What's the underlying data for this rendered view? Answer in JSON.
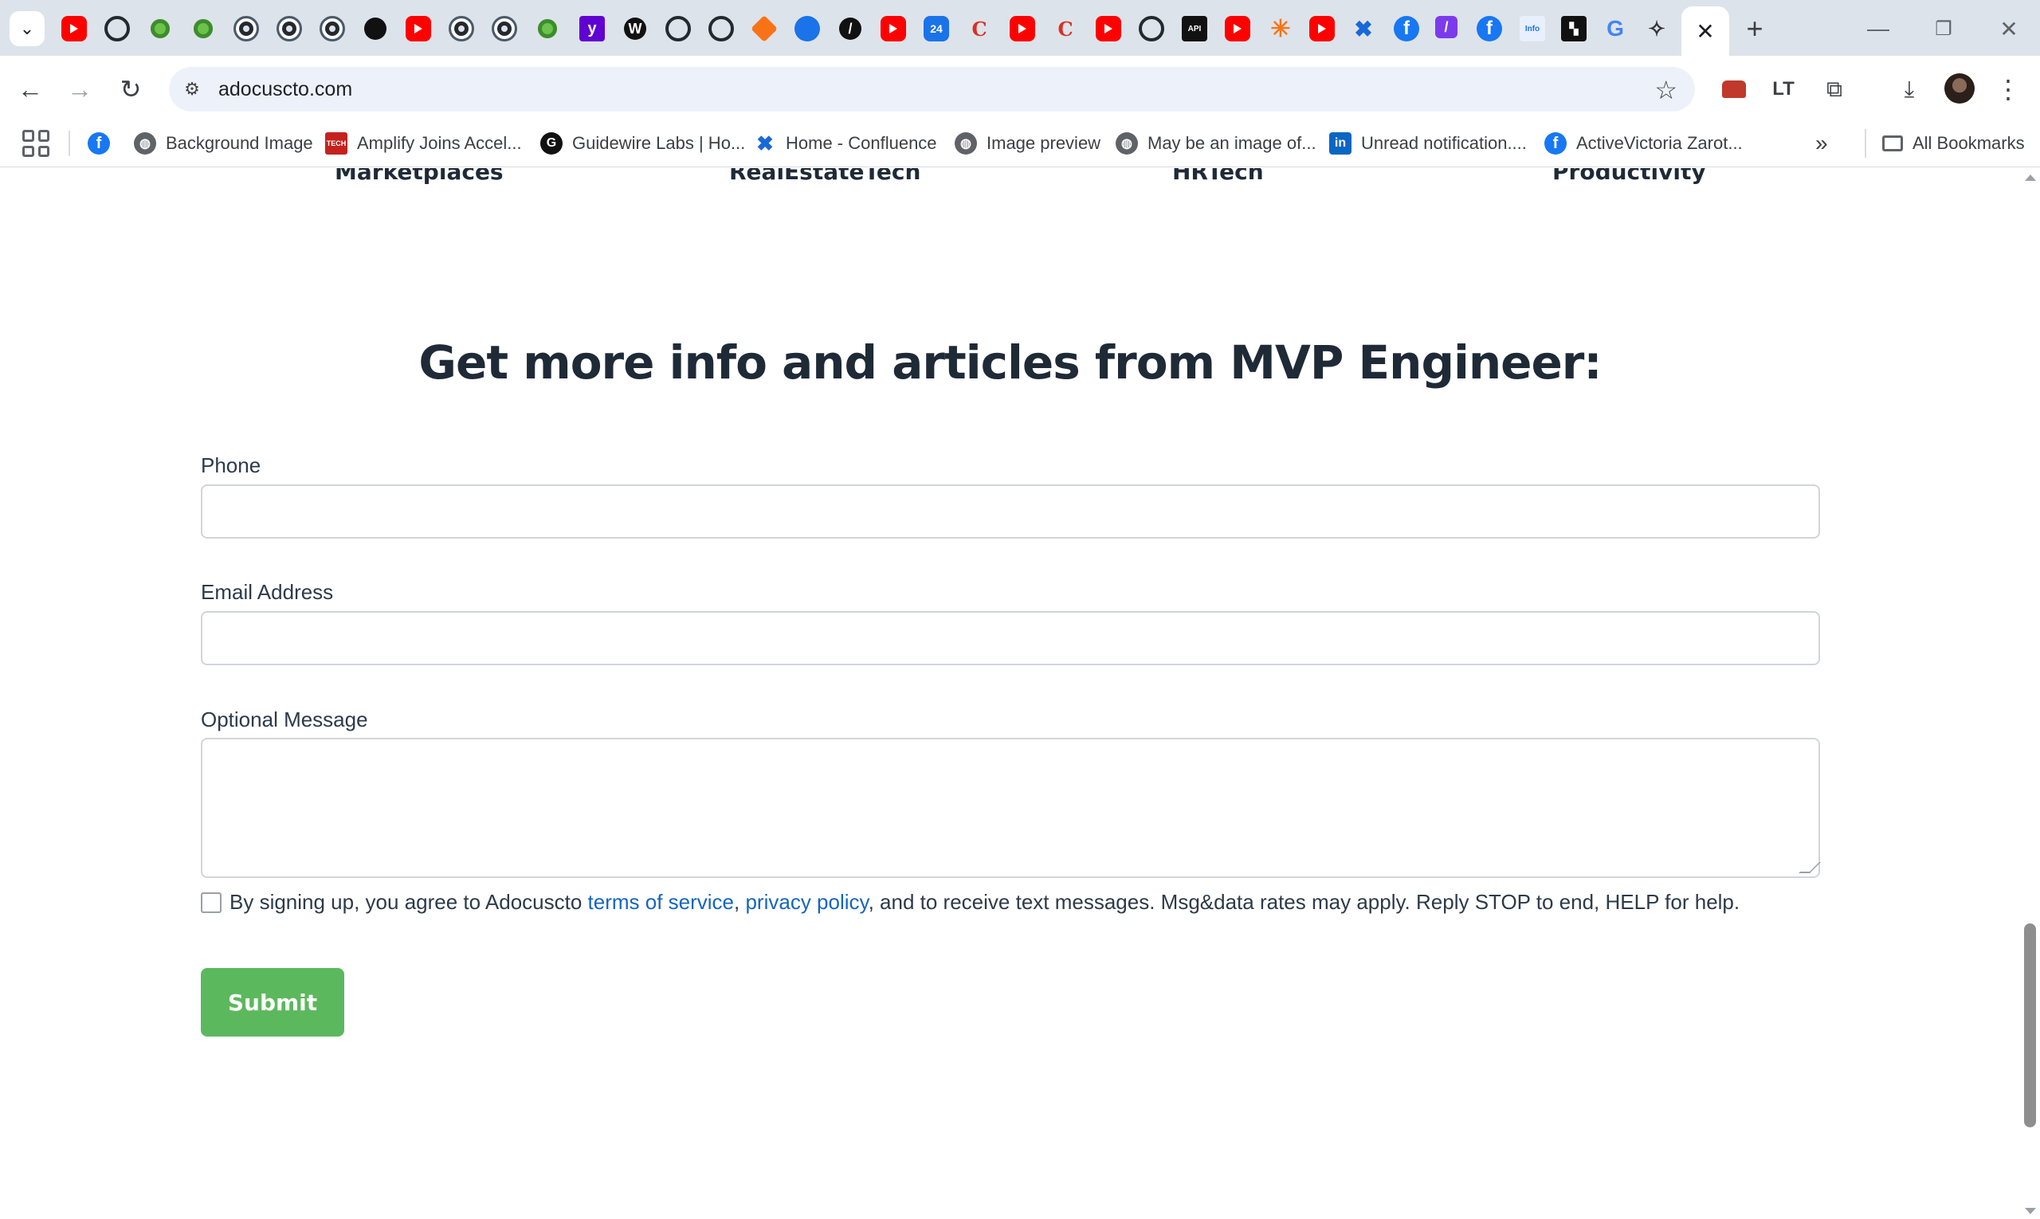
{
  "browser": {
    "url": "adocuscto.com",
    "tab_icons": [
      "youtube-icon",
      "github-icon",
      "spring-icon",
      "spring-icon",
      "github-icon",
      "github-icon",
      "github-icon",
      "openai-icon",
      "youtube-icon",
      "github-icon",
      "github-icon",
      "spring-icon",
      "yahoo-icon",
      "wordpress-icon",
      "github-icon",
      "github-icon",
      "cube-icon",
      "salesforce-icon",
      "slash-icon",
      "youtube-icon",
      "calendar-icon",
      "c-icon",
      "youtube-icon",
      "c-icon",
      "youtube-icon",
      "github-icon",
      "api-icon",
      "youtube-icon",
      "asterisk-icon",
      "youtube-icon",
      "confluence-icon",
      "facebook-icon",
      "slash-icon",
      "facebook-icon",
      "info-icon",
      "dark-icon",
      "google-icon",
      "sparkle-icon"
    ],
    "active_tab_close": "✕",
    "new_tab": "+",
    "window": {
      "minimize": "—",
      "restore": "❐",
      "close": "✕"
    }
  },
  "bookmarks": {
    "items": [
      {
        "label": "",
        "icon": "facebook-icon"
      },
      {
        "label": "Background Image",
        "icon": "globe-icon"
      },
      {
        "label": "Amplify Joins Accel...",
        "icon": "amplify-icon"
      },
      {
        "label": "Guidewire Labs | Ho...",
        "icon": "g-icon"
      },
      {
        "label": "Home - Confluence",
        "icon": "confluence-icon"
      },
      {
        "label": "Image preview",
        "icon": "globe-icon"
      },
      {
        "label": "May be an image of...",
        "icon": "globe-icon"
      },
      {
        "label": "Unread notification....",
        "icon": "linkedin-icon"
      },
      {
        "label": "ActiveVictoria Zarot...",
        "icon": "facebook-icon"
      }
    ],
    "overflow": "»",
    "all_bookmarks": "All Bookmarks"
  },
  "page": {
    "industries": [
      "Marketplaces",
      "RealEstateTech",
      "HRTech",
      "Productivity"
    ],
    "heading": "Get more info and articles from MVP Engineer:",
    "form": {
      "phone_label": "Phone",
      "phone_value": "",
      "email_label": "Email Address",
      "email_value": "",
      "message_label": "Optional Message",
      "message_value": "",
      "consent_prefix": "By signing up, you agree to Adocuscto ",
      "terms_link": "terms of service",
      "comma": ", ",
      "privacy_link": "privacy policy",
      "consent_suffix": ", and to receive text messages. Msg&data rates may apply. Reply STOP to end, HELP for help.",
      "consent_checked": false,
      "submit_label": "Submit"
    }
  },
  "colors": {
    "submit": "#5cb85c",
    "link": "#1565c0",
    "heading": "#1f2a37"
  }
}
